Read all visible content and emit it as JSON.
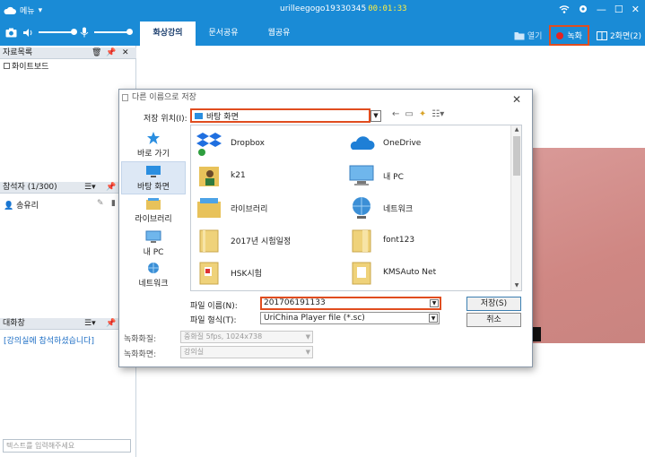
{
  "titlebar": {
    "menu_label": "메뉴",
    "menu_caret": "▾",
    "session_id": "urilleegogo19330345",
    "timer": "00:01:33",
    "minimize": "—",
    "maximize": "☐",
    "close": "✕"
  },
  "toolbar": {
    "tabs": [
      {
        "label": "화상강의",
        "active": true
      },
      {
        "label": "문서공유",
        "active": false
      },
      {
        "label": "웹공유",
        "active": false
      }
    ],
    "open_label": "열기",
    "record_label": "녹화",
    "screen_label": "2화면(2)"
  },
  "left": {
    "materials_header": "자료목록",
    "materials_items": [
      "화이트보드"
    ],
    "participants_header": "참석자 (1/300)",
    "participants": [
      "송유리"
    ],
    "chat_header": "대화창",
    "chat_messages": [
      "[강의실에 참석하셨습니다]"
    ],
    "chat_placeholder": "텍스트를 입력해주세요"
  },
  "dialog": {
    "title": "다른 이름으로 저장",
    "save_in_label": "저장 위치(I):",
    "save_in_value": "바탕 화면",
    "places": [
      {
        "label": "바로 가기",
        "icon": "star-icon"
      },
      {
        "label": "바탕 화면",
        "icon": "desktop-icon",
        "selected": true
      },
      {
        "label": "라이브러리",
        "icon": "library-icon"
      },
      {
        "label": "내 PC",
        "icon": "pc-icon"
      },
      {
        "label": "네트워크",
        "icon": "network-icon"
      }
    ],
    "files": [
      {
        "name": "Dropbox",
        "icon": "dropbox-icon"
      },
      {
        "name": "OneDrive",
        "icon": "onedrive-icon"
      },
      {
        "name": "k21",
        "icon": "user-folder-icon"
      },
      {
        "name": "내 PC",
        "icon": "pc-icon"
      },
      {
        "name": "라이브러리",
        "icon": "library-icon"
      },
      {
        "name": "네트워크",
        "icon": "network-icon"
      },
      {
        "name": "2017년 시험일정",
        "icon": "folder-icon"
      },
      {
        "name": "font123",
        "icon": "folder-icon"
      },
      {
        "name": "HSK시험",
        "icon": "folder-icon"
      },
      {
        "name": "KMSAuto Net",
        "icon": "folder-icon"
      }
    ],
    "filename_label": "파일 이름(N):",
    "filename_value": "201706191133",
    "filetype_label": "파일 형식(T):",
    "filetype_value": "UriChina Player file (*.sc)",
    "save_button": "저장(S)",
    "cancel_button": "취소",
    "quality_label": "녹화화질:",
    "quality_value": "중화질 5fps, 1024x738",
    "screen_label": "녹화화면:",
    "screen_value": "강의실"
  },
  "colors": {
    "brand": "#1a8bd6",
    "highlight": "#e04d1f",
    "record": "#e52222"
  }
}
